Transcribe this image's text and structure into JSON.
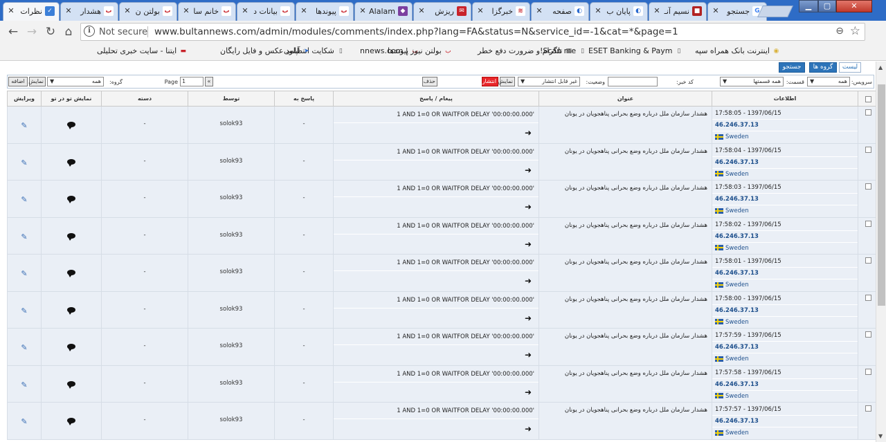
{
  "tabs": [
    {
      "label": "نظرات",
      "active": true,
      "icon": "blue-check"
    },
    {
      "label": "هشدار",
      "icon": "bultan-logo"
    },
    {
      "label": "بولتن ن",
      "icon": "bultan-logo"
    },
    {
      "label": "خانم سا",
      "icon": "bultan-logo"
    },
    {
      "label": "بیانات د",
      "icon": "bultan-logo"
    },
    {
      "label": "پیوندها",
      "icon": "bultan-logo"
    },
    {
      "label": "Alalam",
      "icon": "alalam-logo"
    },
    {
      "label": "ریزش",
      "icon": "red-envelope"
    },
    {
      "label": "خبرگزا",
      "icon": "red-logo"
    },
    {
      "label": "صفحه",
      "icon": "blue-wave"
    },
    {
      "label": "پایان ب",
      "icon": "blue-wave"
    },
    {
      "label": "نسیم آنـ",
      "icon": "red-square"
    },
    {
      "label": "جستجو",
      "icon": "google-g"
    }
  ],
  "window": {
    "minimize": "▁",
    "maximize": "▢",
    "close": "✕"
  },
  "address": {
    "not_secure": "Not secure",
    "url": "www.bultannews.com/admin/modules/comments/index.php?lang=FA&status=N&service_id=-1&cat=*&page=1"
  },
  "bookmarks": [
    {
      "label": "اینترنت بانک همراه سپه",
      "icon": "coin"
    },
    {
      "label": "ESET Banking & Paym",
      "icon": "doc"
    },
    {
      "label": "Scan me!",
      "icon": "doc"
    },
    {
      "label": "تلگرام و ضرورت دفع خطر",
      "icon": "grid"
    },
    {
      "label": "پیوندها",
      "icon": "bultan-logo"
    },
    {
      "label": "بولتن نیوز | nnews.com",
      "icon": "bultan-logo"
    },
    {
      "label": "شکایت انتظامی",
      "icon": "doc"
    },
    {
      "label": "آپلود عکس و فایل رایگان",
      "icon": "arrow"
    },
    {
      "label": "ایتنا - سایت خبری تحلیلی",
      "icon": "itna"
    }
  ],
  "top_tabs": {
    "list": "لیست",
    "groups": "گروه ها",
    "search": "جستجو"
  },
  "filters": {
    "service_label": "سرویس:",
    "service_value": "همه",
    "section_label": "قسمت:",
    "section_value": "همه قسمتها",
    "code_label": "کد خبر:",
    "code_value": "",
    "status_label": "وضعیت:",
    "status_value": "غیر قابل انتشار",
    "show_btn": "نمایش",
    "publish_btn": "انتشار",
    "delete_btn": "حذف",
    "page_label": "Page",
    "page_value": "1",
    "next_btn": "»",
    "group_label": "گروه:",
    "group_value": "همه",
    "show_btn2": "نمایش",
    "add_btn": "اضافه"
  },
  "columns": {
    "info": "اطلاعات",
    "title": "عنوان",
    "message": "پیغام / پاسخ",
    "reply_to": "پاسخ به",
    "by": "توسط",
    "category": "دسته",
    "show_in_tree": "نمایش تو در تو",
    "edit": "ویرایش"
  },
  "rows": [
    {
      "datetime": "17:58:05 - 1397/06/15",
      "ip": "46.246.37.13",
      "country": "Sweden",
      "title": "هشدار سازمان ملل درباره وضع بحرانی پناهجویان در یونان",
      "message": "1 AND 1=0 OR WAITFOR DELAY '00:00:00.000'",
      "reply_to": "-",
      "by": "solok93",
      "category": "-"
    },
    {
      "datetime": "17:58:04 - 1397/06/15",
      "ip": "46.246.37.13",
      "country": "Sweden",
      "title": "هشدار سازمان ملل درباره وضع بحرانی پناهجویان در یونان",
      "message": "1 AND 1=0 OR WAITFOR DELAY '00:00:00.000'",
      "reply_to": "-",
      "by": "solok93",
      "category": "-"
    },
    {
      "datetime": "17:58:03 - 1397/06/15",
      "ip": "46.246.37.13",
      "country": "Sweden",
      "title": "هشدار سازمان ملل درباره وضع بحرانی پناهجویان در یونان",
      "message": "1 AND 1=0 OR WAITFOR DELAY '00:00:00.000'",
      "reply_to": "-",
      "by": "solok93",
      "category": "-"
    },
    {
      "datetime": "17:58:02 - 1397/06/15",
      "ip": "46.246.37.13",
      "country": "Sweden",
      "title": "هشدار سازمان ملل درباره وضع بحرانی پناهجویان در یونان",
      "message": "1 AND 1=0 OR WAITFOR DELAY '00:00:00.000'",
      "reply_to": "-",
      "by": "solok93",
      "category": "-"
    },
    {
      "datetime": "17:58:01 - 1397/06/15",
      "ip": "46.246.37.13",
      "country": "Sweden",
      "title": "هشدار سازمان ملل درباره وضع بحرانی پناهجویان در یونان",
      "message": "1 AND 1=0 OR WAITFOR DELAY '00:00:00.000'",
      "reply_to": "-",
      "by": "solok93",
      "category": "-"
    },
    {
      "datetime": "17:58:00 - 1397/06/15",
      "ip": "46.246.37.13",
      "country": "Sweden",
      "title": "هشدار سازمان ملل درباره وضع بحرانی پناهجویان در یونان",
      "message": "1 AND 1=0 OR WAITFOR DELAY '00:00:00.000'",
      "reply_to": "-",
      "by": "solok93",
      "category": "-"
    },
    {
      "datetime": "17:57:59 - 1397/06/15",
      "ip": "46.246.37.13",
      "country": "Sweden",
      "title": "هشدار سازمان ملل درباره وضع بحرانی پناهجویان در یونان",
      "message": "1 AND 1=0 OR WAITFOR DELAY '00:00:00.000'",
      "reply_to": "-",
      "by": "solok93",
      "category": "-"
    },
    {
      "datetime": "17:57:58 - 1397/06/15",
      "ip": "46.246.37.13",
      "country": "Sweden",
      "title": "هشدار سازمان ملل درباره وضع بحرانی پناهجویان در یونان",
      "message": "1 AND 1=0 OR WAITFOR DELAY '00:00:00.000'",
      "reply_to": "-",
      "by": "solok93",
      "category": "-"
    },
    {
      "datetime": "17:57:57 - 1397/06/15",
      "ip": "46.246.37.13",
      "country": "Sweden",
      "title": "هشدار سازمان ملل درباره وضع بحرانی پناهجویان در یونان",
      "message": "1 AND 1=0 OR WAITFOR DELAY '00:00:00.000'",
      "reply_to": "-",
      "by": "solok93",
      "category": "-"
    }
  ]
}
